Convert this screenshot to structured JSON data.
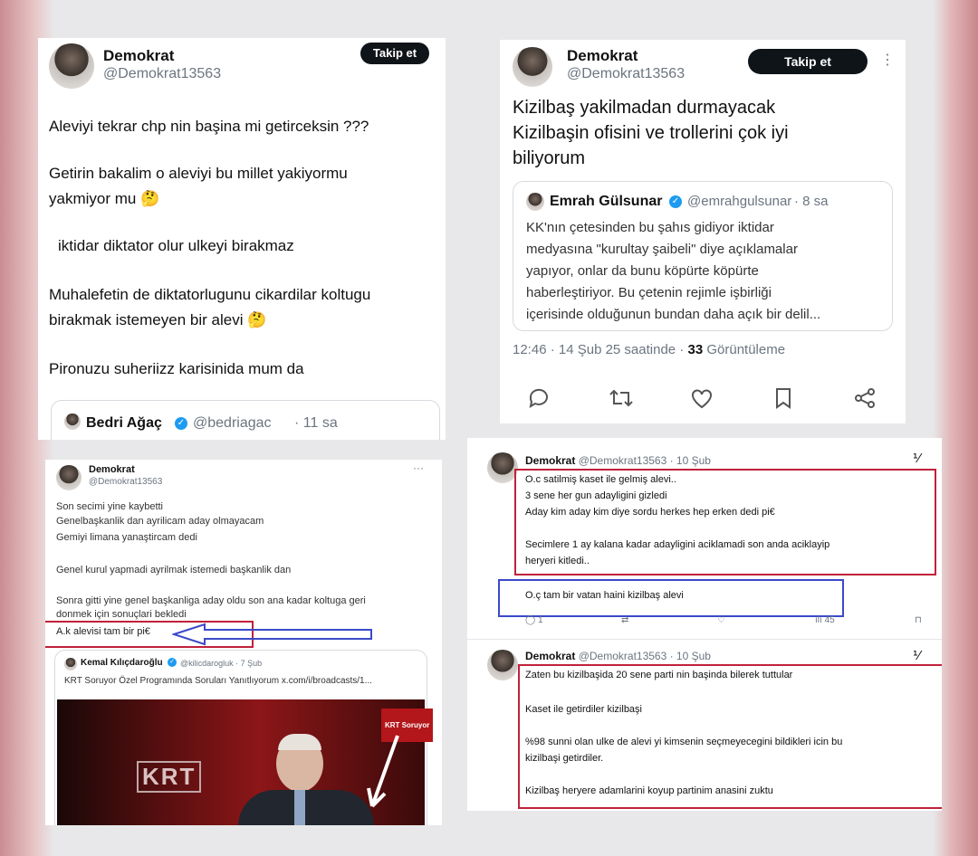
{
  "panel1": {
    "author_name": "Demokrat",
    "author_handle": "@Demokrat13563",
    "follow_label": "Takip et",
    "lines": [
      "Aleviyi tekrar chp nin başina mi getirceksin ???",
      "Getirin bakalim  o aleviyi  bu millet yakiyormu",
      "yakmiyor mu 🤔",
      "iktidar diktator olur ulkeyi birakmaz",
      "Muhalefetin de diktatorlugunu cikardilar  koltugu",
      "birakmak istemeyen bir alevi 🤔",
      "Pironuzu  suheriizz karisinida mum da"
    ],
    "quote_name": "Bedri Ağaç",
    "quote_handle": "@bedriagac",
    "quote_time": "· 11 sa"
  },
  "panel2": {
    "author_name": "Demokrat",
    "author_handle": "@Demokrat13563",
    "follow_label": "Takip et",
    "lines": [
      "Kizilbaş  yakilmadan  durmayacak",
      "Kizilbaşin  ofisini  ve trollerini  çok iyi",
      "biliyorum"
    ],
    "quote_name": "Emrah Gülsunar",
    "quote_handle": "@emrahgulsunar",
    "quote_time": "· 8 sa",
    "quote_lines": [
      "KK'nın çetesinden bu şahıs gidiyor iktidar",
      "medyasına \"kurultay şaibeli\" diye açıklamalar",
      "yapıyor, onlar da bunu köpürte köpürte",
      "haberleştiriyor. Bu çetenin rejimle işbirliği",
      "içerisinde olduğunun bundan daha açık bir delil..."
    ],
    "meta_time": "12:46 · 14 Şub 25 saatinde ·",
    "meta_views_count": "33",
    "meta_views_label": "Görüntüleme"
  },
  "panel3": {
    "author_name": "Demokrat",
    "author_handle": "@Demokrat13563",
    "lines": [
      "Son secimi yine kaybetti",
      "Genelbaşkanlik dan ayrilicam aday olmayacam",
      "Gemiyi limana yanaştircam dedi",
      "Genel kurul yapmadi ayrilmak istemedi başkanlik dan",
      "Sonra gitti yine genel başkanliga aday oldu son ana kadar koltuga geri",
      "donmek için sonuçlari bekledi",
      "A.k alevisi tam bir pi€"
    ],
    "quote_name": "Kemal Kılıçdaroğlu",
    "quote_handle": "@kilicdarogluk · 7 Şub",
    "quote_text": "KRT Soruyor Özel Programında Soruları Yanıtlıyorum x.com/i/broadcasts/1...",
    "video_logo": "KRT",
    "video_badge": "KRT Soruyor"
  },
  "panel4": {
    "post1": {
      "author_name": "Demokrat",
      "author_handle": "@Demokrat13563 · 10 Şub",
      "lines": [
        "O.c  satilmiş kaset ile gelmiş alevi..",
        "3 sene her gun adayligini gizledi",
        "Aday kim aday kim diye sordu herkes hep erken dedi  pi€",
        "Secimlere 1 ay kalana kadar adayligini aciklamadi  son anda aciklayip",
        "heryeri kitledi.."
      ],
      "highlight": "O.ç tam bir vatan haini kizilbaş alevi",
      "stat_replies": "1",
      "stat_views": "45"
    },
    "post2": {
      "author_name": "Demokrat",
      "author_handle": "@Demokrat13563 · 10 Şub",
      "lines": [
        "Zaten bu kizilbaşida 20 sene parti nin başinda bilerek tuttular",
        "Kaset ile getirdiler  kizilbaşi",
        "%98 sunni olan ulke de  alevi yi kimsenin seçmeyecegini bildikleri icin bu",
        "kizilbaşi getirdiler.",
        "Kizilbaş  heryere adamlarini koyup partinim  anasini zuktu"
      ]
    }
  },
  "colors": {
    "red_annotation": "#c0213a",
    "blue_annotation": "#3b49c9",
    "verified_blue": "#1d9bf0"
  }
}
